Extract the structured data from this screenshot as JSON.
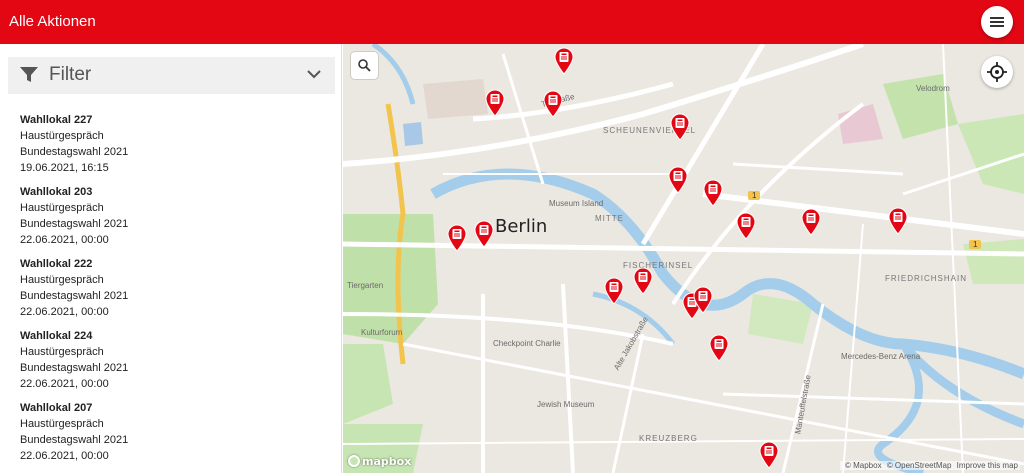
{
  "header": {
    "title": "Alle Aktionen",
    "menu_icon": "hamburger-menu-icon"
  },
  "filter": {
    "label": "Filter",
    "icon": "funnel-icon",
    "toggle_icon": "chevron-down-icon"
  },
  "actions": [
    {
      "name": "Wahllokal 227",
      "type": "Haustürgespräch",
      "campaign": "Bundestagswahl 2021",
      "date": "19.06.2021, 16:15"
    },
    {
      "name": "Wahllokal 203",
      "type": "Haustürgespräch",
      "campaign": "Bundestagswahl 2021",
      "date": "22.06.2021, 00:00"
    },
    {
      "name": "Wahllokal 222",
      "type": "Haustürgespräch",
      "campaign": "Bundestagswahl 2021",
      "date": "22.06.2021, 00:00"
    },
    {
      "name": "Wahllokal 224",
      "type": "Haustürgespräch",
      "campaign": "Bundestagswahl 2021",
      "date": "22.06.2021, 00:00"
    },
    {
      "name": "Wahllokal 207",
      "type": "Haustürgespräch",
      "campaign": "Bundestagswahl 2021",
      "date": "22.06.2021, 00:00"
    }
  ],
  "map": {
    "city": "Berlin",
    "labels": {
      "scheunenviertel": "SCHEUNENVIERTEL",
      "mitte": "MITTE",
      "fischerinsel": "FISCHERINSEL",
      "friedrichshain": "FRIEDRICHSHAIN",
      "kreuzberg": "KREUZBERG",
      "museum_island": "Museum Island",
      "tiergarten": "Tiergarten",
      "kulturforum": "Kulturforum",
      "checkpoint": "Checkpoint Charlie",
      "jewish_museum": "Jewish Museum",
      "mercedes": "Mercedes-Benz Arena",
      "velodrom": "Velodrom",
      "torstrasse": "Torstraße",
      "jakobstrasse": "Alte Jakobstraße",
      "manteuffel": "Manteuffelstraße",
      "route1a": "1",
      "route1b": "1"
    },
    "attribution": {
      "mapbox": "© Mapbox",
      "osm": "© OpenStreetMap",
      "improve": "Improve this map"
    },
    "logo": "mapbox",
    "search_icon": "search-icon",
    "locate_icon": "crosshair-locate-icon",
    "marker_icon": "ballot-box-marker-icon",
    "marker_color": "#e30613",
    "accent_color": "#e30613"
  }
}
